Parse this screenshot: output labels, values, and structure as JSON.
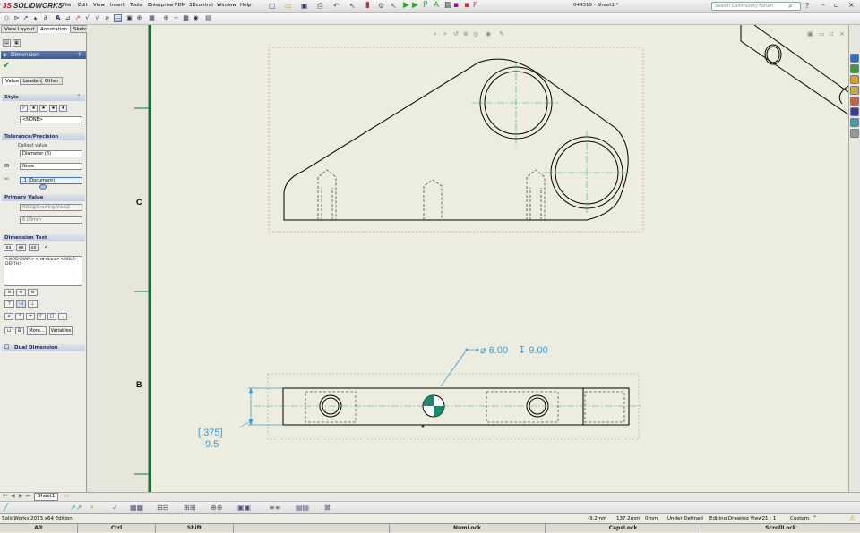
{
  "app": {
    "logo_a": "3S",
    "logo_b": "SOLIDWORKS",
    "title": "044319 - Sheet1 *",
    "search_placeholder": "Search Community Forum"
  },
  "menus": [
    "File",
    "Edit",
    "View",
    "Insert",
    "Tools",
    "Enterprise PDM",
    "3Dcontrol",
    "Window",
    "Help"
  ],
  "cm_tabs": [
    "View Layout",
    "Annotation",
    "Sketch"
  ],
  "pm": {
    "title": "Dimension",
    "help": "?",
    "tabs": [
      "Value",
      "Leaders",
      "Other"
    ],
    "style": {
      "header": "Style",
      "select": "<NONE>"
    },
    "tolerance": {
      "header": "Tolerance/Precision",
      "callout_label": "Callout value",
      "callout_select": "Diameter (6)",
      "tol_select": "None",
      "precision_select": ".1 (Document)"
    },
    "primary": {
      "header": "Primary Value",
      "name": "RD2@Drawing View2",
      "value": "6.00mm"
    },
    "dimtext": {
      "header": "Dimension Text",
      "text": "<MOD-DIAM> <hw-diam> <HOLE-DEPTH>",
      "more": "More...",
      "variables": "Variables"
    },
    "dual": {
      "header": "Dual Dimension"
    }
  },
  "sheet": {
    "zone_c": "C",
    "zone_b": "B",
    "callout_dia": "⌀ 6.00",
    "callout_depth": "↧ 9.00",
    "dim_inch": "[.375]",
    "dim_mm": "9.5"
  },
  "sheet_tab": "Sheet1",
  "status": {
    "edition": "SolidWorks 2013 x64 Edition",
    "x": "-3.2mm",
    "y": "137.2mm",
    "z": "0mm",
    "state": "Under Defined",
    "editing": "Editing Drawing View2",
    "scale": "1 : 1",
    "units": "Custom"
  },
  "keys": [
    "Alt",
    "Ctrl",
    "Shift",
    "",
    "NumLock",
    "",
    "CapsLock",
    "ScrollLock"
  ],
  "colors": {
    "dim": "#3b9bd6",
    "sheet": "#eceddf",
    "border": "#0a7a2e",
    "accent": "#1a8a70"
  }
}
